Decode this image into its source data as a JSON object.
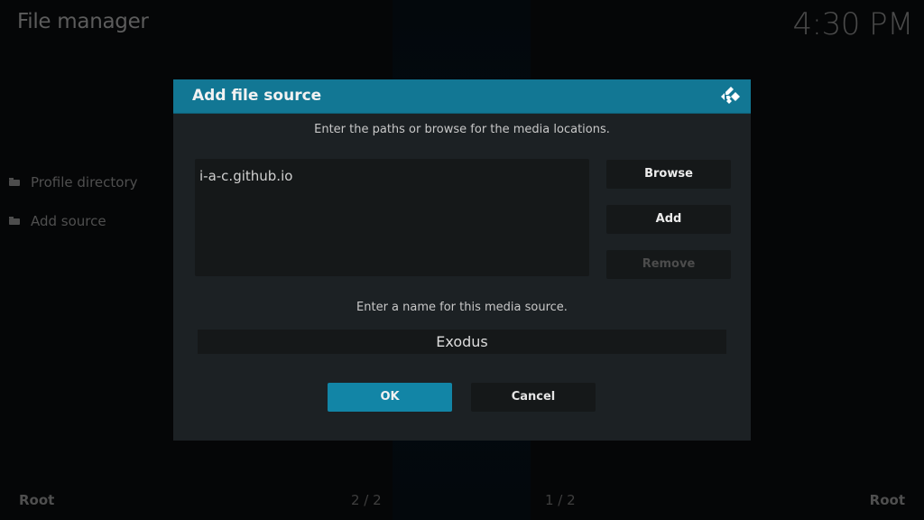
{
  "header": {
    "title": "File manager",
    "clock": "4:30 PM"
  },
  "sidebar": {
    "items": [
      {
        "label": "Profile directory",
        "icon": "folder-icon"
      },
      {
        "label": "Add source",
        "icon": "folder-icon"
      }
    ]
  },
  "footer": {
    "left_label": "Root",
    "right_label": "Root",
    "left_page": "2 / 2",
    "right_page": "1 / 2"
  },
  "dialog": {
    "title": "Add file source",
    "logo_icon": "kodi-logo-icon",
    "paths_instruction": "Enter the paths or browse for the media locations.",
    "paths": [
      "i-a-c.github.io"
    ],
    "buttons": {
      "browse": "Browse",
      "add": "Add",
      "remove": "Remove"
    },
    "name_instruction": "Enter a name for this media source.",
    "name_value": "Exodus",
    "ok_label": "OK",
    "cancel_label": "Cancel"
  },
  "colors": {
    "accent": "#127794",
    "ok_button": "#1285a6",
    "dialog_bg": "#1c2124",
    "field_bg": "#151819",
    "background": "#050607"
  }
}
